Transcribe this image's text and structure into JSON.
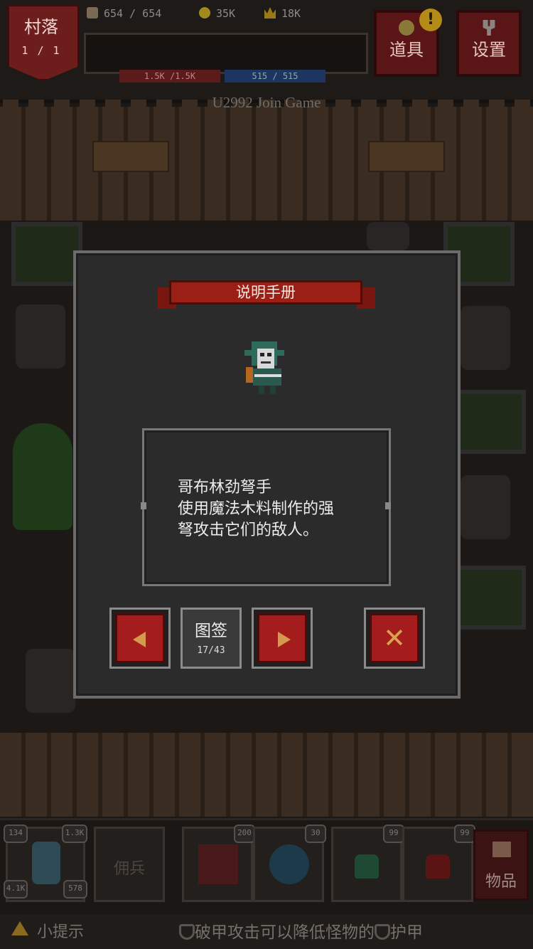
{
  "village": {
    "title": "村落",
    "level": "1 / 1"
  },
  "stats": [
    {
      "icon": "bag-icon",
      "value": "654 / 654",
      "color": "#7a6a55"
    },
    {
      "icon": "coin-icon",
      "value": "35K",
      "color": "#a08a1e"
    },
    {
      "icon": "crown-icon",
      "value": "18K",
      "color": "#9a7a16"
    }
  ],
  "bars": {
    "hp": "1.5K /1.5K",
    "mp": "515 / 515"
  },
  "header_buttons": {
    "items": "道具",
    "settings": "设置",
    "notification": "!"
  },
  "join_text": "U2992 Join Game",
  "dialog": {
    "title": "说明手册",
    "description": [
      "哥布林劲弩手",
      "使用魔法木料制作的强",
      "弩攻击它们的敌人。"
    ],
    "guide_label": "图签",
    "guide_count": "17/43",
    "close_symbol": "✕"
  },
  "bottom": {
    "mercenary_label": "佣兵",
    "hero_stats": [
      "134",
      "1.3K",
      "4.1K",
      "578"
    ],
    "skill_badges": [
      "200",
      "30"
    ],
    "potion_badges": [
      "99",
      "99"
    ],
    "items_label": "物品"
  },
  "tip": {
    "label": "小提示",
    "text_part1": "破甲攻击可以降低怪物的",
    "text_part2": "护甲"
  }
}
